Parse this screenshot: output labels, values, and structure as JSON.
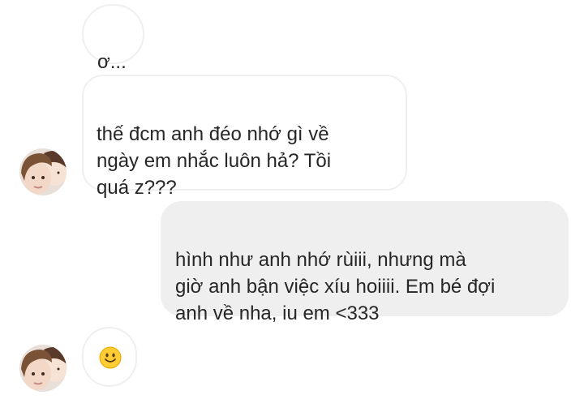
{
  "messages": [
    {
      "sender": "other",
      "text": "ơ..."
    },
    {
      "sender": "other",
      "text": "thế đcm anh đéo nhớ gì về\nngày em nhắc luôn hả? Tồi\nquá z???"
    },
    {
      "sender": "me",
      "text": "hình như anh nhớ rùiii, nhưng mà\ngiờ anh bận việc xíu hoiiii. Em bé đợi\nanh về nha, iu em <333"
    },
    {
      "sender": "other",
      "icon": "smiley-emoji-icon"
    }
  ],
  "colors": {
    "incoming_bubble_border": "#efefef",
    "outgoing_bubble_bg": "#efefef",
    "text": "#262626",
    "emoji_fill": "#ffcc33"
  }
}
